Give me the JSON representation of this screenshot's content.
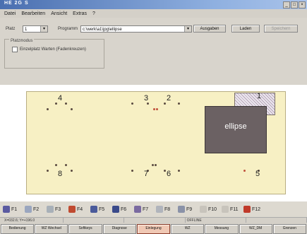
{
  "window": {
    "title": "HE 2G S",
    "controls": [
      "_",
      "□",
      "×"
    ]
  },
  "menu": [
    "Datei",
    "Bearbeiten",
    "Ansicht",
    "Extras",
    "?"
  ],
  "toolbar": {
    "platz_label": "Platz",
    "platz_value": "1",
    "programm_label": "Programm",
    "programm_value": "c:\\werk\\a1\\jpg\\ellipse",
    "buttons": [
      "Ausgaben",
      "Laden",
      "Speichern"
    ],
    "group_label": "Platzmodus",
    "checkbox_label": "Einzelplatz Warten (Fadenkreuzen)"
  },
  "board": {
    "numbers": [
      "4",
      "3",
      "2",
      "1",
      "8",
      "7",
      "6",
      "5"
    ],
    "shape_label": "ellipse"
  },
  "fkeys": [
    "F1",
    "F2",
    "F3",
    "F4",
    "F5",
    "F6",
    "F7",
    "F8",
    "F9",
    "F10",
    "F11",
    "F12"
  ],
  "status": [
    "X=032.6; Y=+196.0",
    "",
    "",
    "OFFLINE",
    ""
  ],
  "taskbar": [
    "Bedienung",
    "WZ Wechsel",
    "Softkeys",
    "Diagnose",
    "Einlegung",
    "WZ",
    "Messung",
    "WZ_DM",
    "Grenzen"
  ],
  "colors": {
    "active_task": "#f0c8b4",
    "board": "#f7f0c4",
    "shape": "#6b6163"
  }
}
